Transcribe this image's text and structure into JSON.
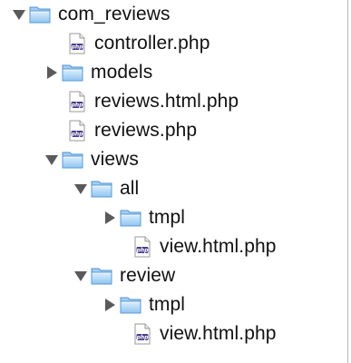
{
  "tree": {
    "items": [
      {
        "label": "com_reviews",
        "type": "folder",
        "expanded": true,
        "level": 0
      },
      {
        "label": "controller.php",
        "type": "php-file",
        "level": 1
      },
      {
        "label": "models",
        "type": "folder",
        "expanded": false,
        "level": 0
      },
      {
        "label": "reviews.html.php",
        "type": "php-file",
        "level": 1
      },
      {
        "label": "reviews.php",
        "type": "php-file",
        "level": 1
      },
      {
        "label": "views",
        "type": "folder",
        "expanded": true,
        "level": 1
      },
      {
        "label": "all",
        "type": "folder",
        "expanded": true,
        "level": 2
      },
      {
        "label": "tmpl",
        "type": "folder",
        "expanded": false,
        "level": 3
      },
      {
        "label": "view.html.php",
        "type": "php-file",
        "level": 4
      },
      {
        "label": "review",
        "type": "folder",
        "expanded": true,
        "level": 2
      },
      {
        "label": "tmpl",
        "type": "folder",
        "expanded": false,
        "level": 3
      },
      {
        "label": "view.html.php",
        "type": "php-file",
        "level": 4
      }
    ]
  },
  "icons": {
    "folder": "folder-icon",
    "php_file": "php-file-icon",
    "expanded": "triangle-down-icon",
    "collapsed": "triangle-right-icon",
    "php_badge": "php"
  },
  "colors": {
    "folder_light": "#cfe7fb",
    "folder_mid": "#8cc3f2",
    "folder_dark": "#4f95d8",
    "triangle": "#5a5a5a",
    "php_purple": "#4a3a8c",
    "text": "#111111"
  }
}
